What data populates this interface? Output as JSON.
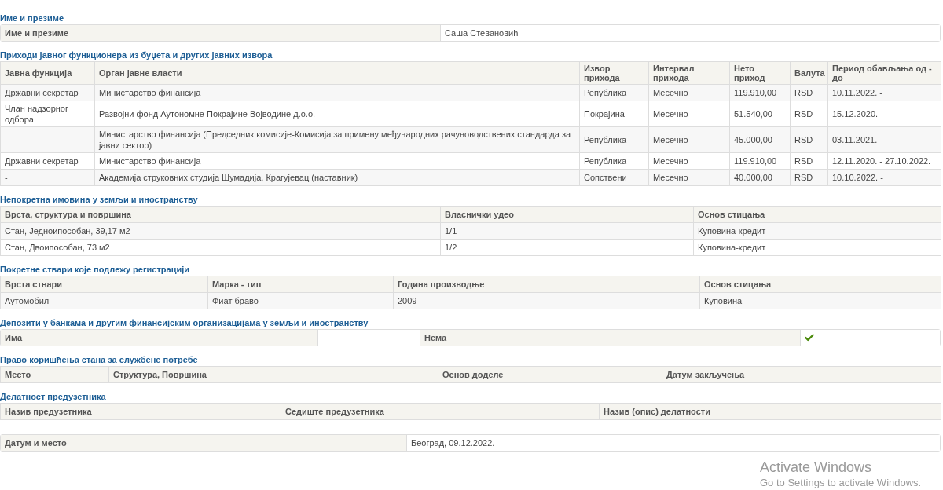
{
  "sections": [
    {
      "kind": "keyvalue",
      "title": "Име и презиме",
      "label": "Име и презиме",
      "value": "Саша Стевановић"
    },
    {
      "kind": "table",
      "title": "Приходи јавног функционера из буџета и других јавних извора",
      "columns": [
        "Јавна функција",
        "Орган јавне власти",
        "Извор прихода",
        "Интервал прихода",
        "Нето приход",
        "Валута",
        "Период обављања од - до"
      ],
      "rows": [
        [
          "Државни секретар",
          "Министарство финансија",
          "Република",
          "Месечно",
          "119.910,00",
          "RSD",
          "10.11.2022. -"
        ],
        [
          "Члан надзорног одбора",
          "Развојни фонд Аутономне Покрајине Војводине д.о.о.",
          "Покрајина",
          "Месечно",
          "51.540,00",
          "RSD",
          "15.12.2020. -"
        ],
        [
          "-",
          "Министарство финансија (Председник комисије-Комисија за примену међународних рачуноводствених стандарда за јавни сектор)",
          "Република",
          "Месечно",
          "45.000,00",
          "RSD",
          "03.11.2021. -"
        ],
        [
          "Државни секретар",
          "Министарство финансија",
          "Република",
          "Месечно",
          "119.910,00",
          "RSD",
          "12.11.2020. - 27.10.2022."
        ],
        [
          "-",
          "Академија струковних студија Шумадија, Крагујевац (наставник)",
          "Сопствени",
          "Месечно",
          "40.000,00",
          "RSD",
          "10.10.2022. -"
        ]
      ]
    },
    {
      "kind": "table",
      "title": "Непокретна имовина у земљи и иностранству",
      "columns": [
        "Врста, структура и површина",
        "Власнички удео",
        "Основ стицања"
      ],
      "rows": [
        [
          "Стан, Једноипособан, 39,17 м2",
          "1/1",
          "Куповина-кредит"
        ],
        [
          "Стан, Двоипособан, 73 м2",
          "1/2",
          "Куповина-кредит"
        ]
      ]
    },
    {
      "kind": "table",
      "title": "Покретне ствари које подлежу регистрацији",
      "columns": [
        "Врста ствари",
        "Марка - тип",
        "Година производње",
        "Основ стицања"
      ],
      "rows": [
        [
          "Аутомобил",
          "Фиат браво",
          "2009",
          "Куповина"
        ]
      ]
    },
    {
      "kind": "yesno",
      "title": "Депозити у банкама и другим финансијским организацијама у земљи и иностранству",
      "options": [
        {
          "label": "Има",
          "checked": false
        },
        {
          "label": "Нема",
          "checked": true
        }
      ]
    },
    {
      "kind": "table",
      "title": "Право коришћења стана за службене потребе",
      "columns": [
        "Место",
        "Структура, Површина",
        "Основ доделе",
        "Датум закључења"
      ]
    },
    {
      "kind": "table",
      "title": "Делатност предузетника",
      "columns": [
        "Назив предузетника",
        "Седиште предузетника",
        "Назив (опис) делатности"
      ]
    },
    {
      "kind": "keyvalue",
      "label": "Датум и место",
      "value": "Београд, 09.12.2022."
    }
  ],
  "os_notice": {
    "title": "Activate Windows",
    "text": "Go to Settings to activate Windows."
  }
}
